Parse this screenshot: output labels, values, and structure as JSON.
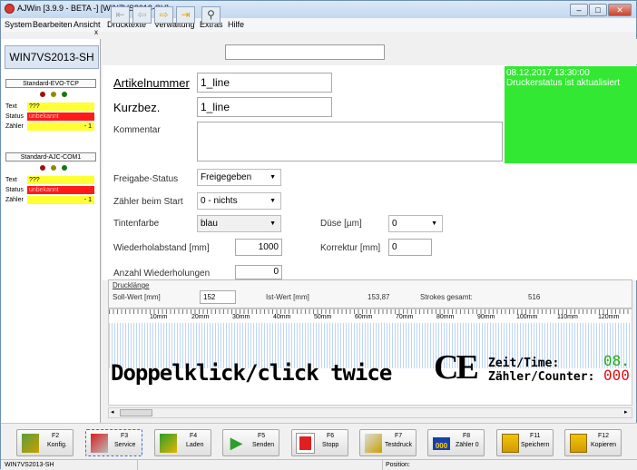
{
  "window": {
    "title": "AJWin [3.9.9 - BETA -] [WIN7VS2013-SH]"
  },
  "menu": [
    "System",
    "Bearbeiten",
    "Ansicht",
    "Drucktexte",
    "Verwaltung",
    "Extras",
    "Hilfe"
  ],
  "left_panel": {
    "tab_label": "WIN7VS2013-SH",
    "devices": [
      {
        "name": "Standard-EVO-TCP",
        "text_label": "Text",
        "text_value": "???",
        "status_label": "Status",
        "status_value": "unbekannt",
        "counter_label": "Zähler",
        "counter_value": "- 1"
      },
      {
        "name": "Standard-AJC-COM1",
        "text_label": "Text",
        "text_value": "???",
        "status_label": "Status",
        "status_value": "unbekannt",
        "counter_label": "Zähler",
        "counter_value": "- 1"
      }
    ]
  },
  "form": {
    "artikel_label": "Artikelnummer",
    "artikel_value": "1_line",
    "kurz_label": "Kurzbez.",
    "kurz_value": "1_line",
    "kommentar_label": "Kommentar",
    "kommentar_value": "",
    "freigabe_label": "Freigabe-Status",
    "freigabe_value": "Freigegeben",
    "zaehler_label": "Zähler beim Start",
    "zaehler_value": "0 - nichts",
    "tinte_label": "Tintenfarbe",
    "tinte_value": "blau",
    "duese_label": "Düse [µm]",
    "duese_value": "0",
    "wiederhol_label": "Wiederholabstand [mm]",
    "wiederhol_value": "1000",
    "korrektur_label": "Korrektur [mm]",
    "korrektur_value": "0",
    "anzahl_label": "Anzahl Wiederholungen",
    "anzahl_value": "0"
  },
  "status_panel": {
    "timestamp": "08.12.2017 13:30:00",
    "message": "Druckerstatus ist aktualisiert"
  },
  "drucklaenge": {
    "title": "Drucklänge",
    "soll_label": "Soll-Wert [mm]",
    "soll_value": "152",
    "ist_label": "Ist-Wert [mm]",
    "ist_value": "153,87",
    "strokes_label": "Strokes gesamt:",
    "strokes_value": "516"
  },
  "preview": {
    "ruler": [
      "10mm",
      "20mm",
      "30mm",
      "40mm",
      "50mm",
      "60mm",
      "70mm",
      "80mm",
      "90mm",
      "100mm",
      "110mm",
      "120mm"
    ],
    "main_text": "Doppelklick/click twice",
    "ce_mark": "CE",
    "zeit_label": "Zeit/Time:",
    "zaehler_label": "Zähler/Counter:",
    "zeit_value": "08.",
    "counter_value": "000"
  },
  "fkeys": [
    {
      "key": "F2",
      "label": "Konfig."
    },
    {
      "key": "F3",
      "label": "Service"
    },
    {
      "key": "F4",
      "label": "Laden"
    },
    {
      "key": "F5",
      "label": "Senden"
    },
    {
      "key": "F6",
      "label": "Stopp"
    },
    {
      "key": "F7",
      "label": "Testdruck"
    },
    {
      "key": "F8",
      "label": "Zähler 0"
    },
    {
      "key": "F11",
      "label": "Speichern"
    },
    {
      "key": "F12",
      "label": "Kopieren"
    }
  ],
  "statusbar": {
    "left": "WIN7VS2013-SH",
    "position_label": "Position:"
  },
  "colors": {
    "status_green": "#33e833",
    "unknown_red": "#ff1a1a",
    "yellow": "#ffff33",
    "counter_green": "#22aa22",
    "counter_red": "#e01010"
  }
}
